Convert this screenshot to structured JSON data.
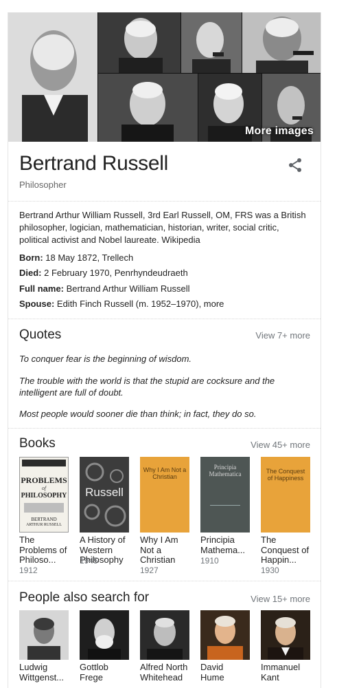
{
  "collage": {
    "more_images_label": "More images"
  },
  "header": {
    "title": "Bertrand Russell",
    "subtitle": "Philosopher"
  },
  "description": {
    "text": "Bertrand Arthur William Russell, 3rd Earl Russell, OM, FRS was a British philosopher, logician, mathematician, historian, writer, social critic, political activist and Nobel laureate.",
    "source": "Wikipedia"
  },
  "facts": [
    {
      "label": "Born:",
      "value": " 18 May 1872, ",
      "link": "Trellech"
    },
    {
      "label": "Died:",
      "value": " 2 February 1970, ",
      "link": "Penrhyndeudraeth"
    },
    {
      "label": "Full name:",
      "value": " Bertrand Arthur William Russell",
      "link": ""
    },
    {
      "label": "Spouse:",
      "value": " Edith Finch Russell (m. 1952–1970), ",
      "link": "more"
    }
  ],
  "quotes": {
    "title": "Quotes",
    "view_more": "View 7+ more",
    "items": [
      "To conquer fear is the beginning of wisdom.",
      "The trouble with the world is that the stupid are cocksure and the intelligent are full of doubt.",
      "Most people would sooner die than think; in fact, they do so."
    ]
  },
  "books": {
    "title": "Books",
    "view_more": "View 45+ more",
    "items": [
      {
        "title_lines": [
          "The",
          "Problems of",
          "Philoso..."
        ],
        "year": "1912",
        "cover_lines": [
          "PROBLEMS",
          "PHILOSOPHY",
          "BERTRAND",
          "ARTHUR RUSSELL"
        ]
      },
      {
        "title_lines": [
          "A History of",
          "Western",
          "Philosophy"
        ],
        "year": "1945",
        "cover_lines": [
          "Russell"
        ]
      },
      {
        "title_lines": [
          "Why I Am",
          "Not a",
          "Christian"
        ],
        "year": "1927",
        "cover_lines": [
          "Why I Am Not a",
          "Christian"
        ]
      },
      {
        "title_lines": [
          "Principia",
          "Mathema..."
        ],
        "year": "1910",
        "cover_lines": [
          "Principia",
          "Mathematica"
        ]
      },
      {
        "title_lines": [
          "The",
          "Conquest of",
          "Happin..."
        ],
        "year": "1930",
        "cover_lines": [
          "The Conquest",
          "of Happiness"
        ]
      }
    ]
  },
  "people": {
    "title": "People also search for",
    "view_more": "View 15+ more",
    "items": [
      {
        "name_lines": [
          "Ludwig",
          "Wittgenst..."
        ]
      },
      {
        "name_lines": [
          "Gottlob",
          "Frege"
        ]
      },
      {
        "name_lines": [
          "Alfred North",
          "Whitehead"
        ]
      },
      {
        "name_lines": [
          "David",
          "Hume"
        ]
      },
      {
        "name_lines": [
          "Immanuel",
          "Kant"
        ]
      }
    ]
  },
  "colors": {
    "muted_text": "#70757a",
    "book_orange": "#e8a33a",
    "book_gray": "#4e5654"
  }
}
